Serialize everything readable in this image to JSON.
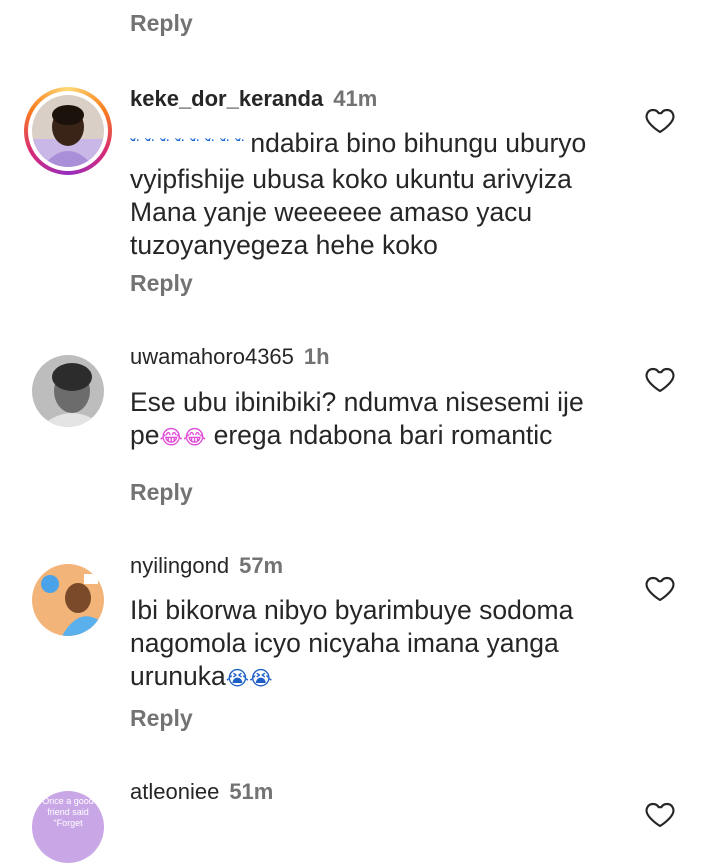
{
  "reply_label": "Reply",
  "comments": [
    {
      "username": "keke_dor_keranda",
      "time": "41m",
      "emoji": "ˇ̈ ˇ̈ ˇ̈ ˇ̈ ˇ̈ ˇ̈ ˇ̈ ˇ̈",
      "text": "ndabira bino bihungu uburyo vyipfishije ubusa koko ukuntu arivyiza Mana yanje weeeeee amaso yacu tuzoyanyegeza hehe koko",
      "avatar_icon": "profile-photo-with-story-ring"
    },
    {
      "username": "uwamahoro4365",
      "time": "1h",
      "text_before": "Ese ubu ibinibiki? ndumva nisesemi ije pe",
      "emoji": "😂😂",
      "text_after": " erega ndabona bari romantic",
      "avatar_icon": "profile-photo"
    },
    {
      "username": "nyilingond",
      "time": "57m",
      "text_before": "Ibi bikorwa nibyo byarimbuye sodoma nagomola icyo nicyaha imana yanga urunuka",
      "emoji": "😭😭",
      "avatar_icon": "profile-photo"
    },
    {
      "username": "atleoniee",
      "time": "51m",
      "avatar_text": "Once a good friend said \"Forget",
      "avatar_icon": "profile-photo"
    }
  ],
  "icons": {
    "like": "heart-outline-icon"
  },
  "colors": {
    "text": "#262626",
    "muted": "#737373",
    "heart": "#262626"
  }
}
